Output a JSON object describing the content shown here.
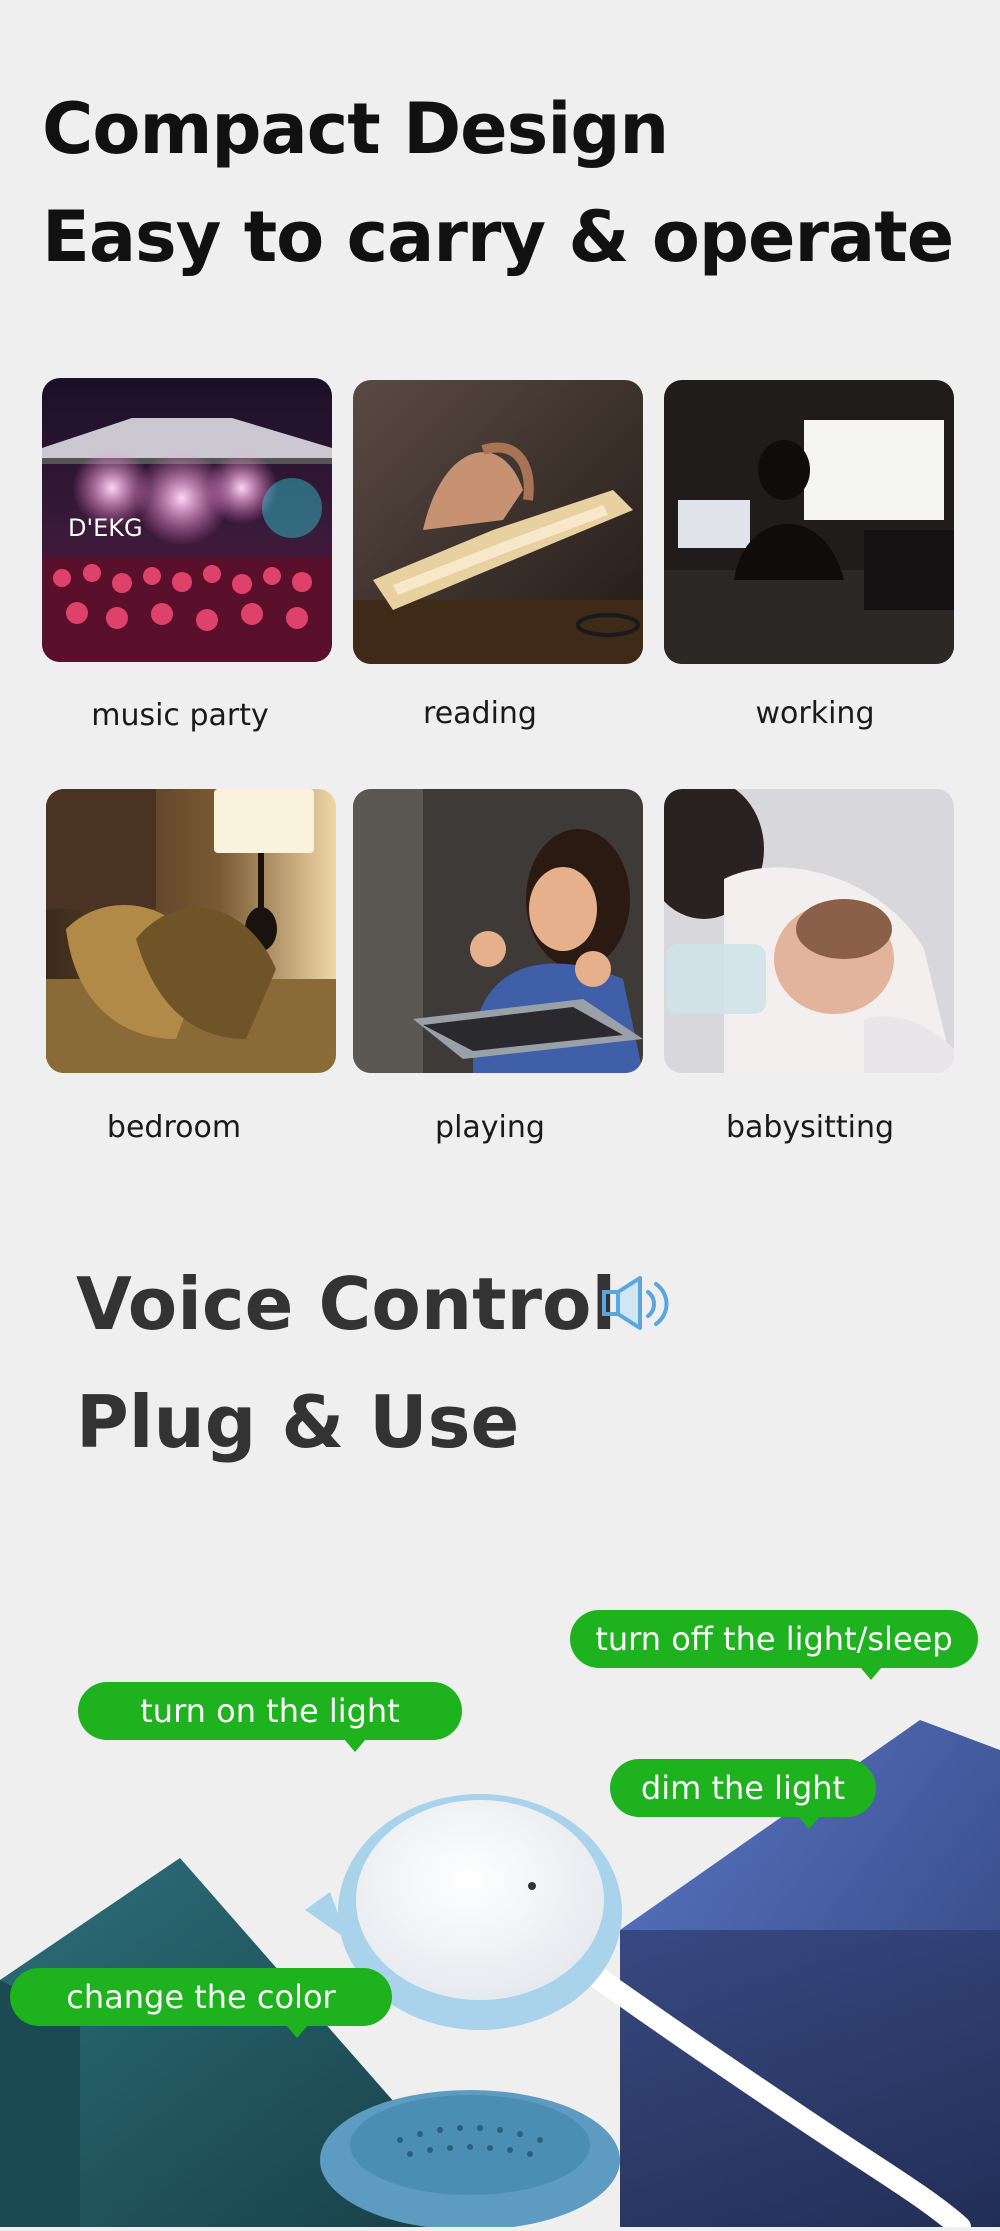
{
  "heading": {
    "line1": "Compact Design",
    "line2": "Easy to carry & operate"
  },
  "scenarios": [
    {
      "label": "music party",
      "icon": "concert-photo"
    },
    {
      "label": "reading",
      "icon": "book-photo"
    },
    {
      "label": "working",
      "icon": "computer-photo"
    },
    {
      "label": "bedroom",
      "icon": "bed-photo"
    },
    {
      "label": "playing",
      "icon": "gaming-photo"
    },
    {
      "label": "babysitting",
      "icon": "baby-photo"
    }
  ],
  "concert_sign": "D'EKG",
  "voice": {
    "line1": "Voice Control",
    "line2": "Plug & Use",
    "icon": "speaker-icon"
  },
  "commands": {
    "sleep": "turn off the light/sleep",
    "on": "turn on the light",
    "dim": "dim the light",
    "color": "change the color"
  },
  "colors": {
    "bubble": "#1eb21e",
    "speaker_icon": "#5aa6e0",
    "device_body": "#a9d3ea",
    "block_blue": "#3d5390",
    "block_teal": "#23606a"
  }
}
